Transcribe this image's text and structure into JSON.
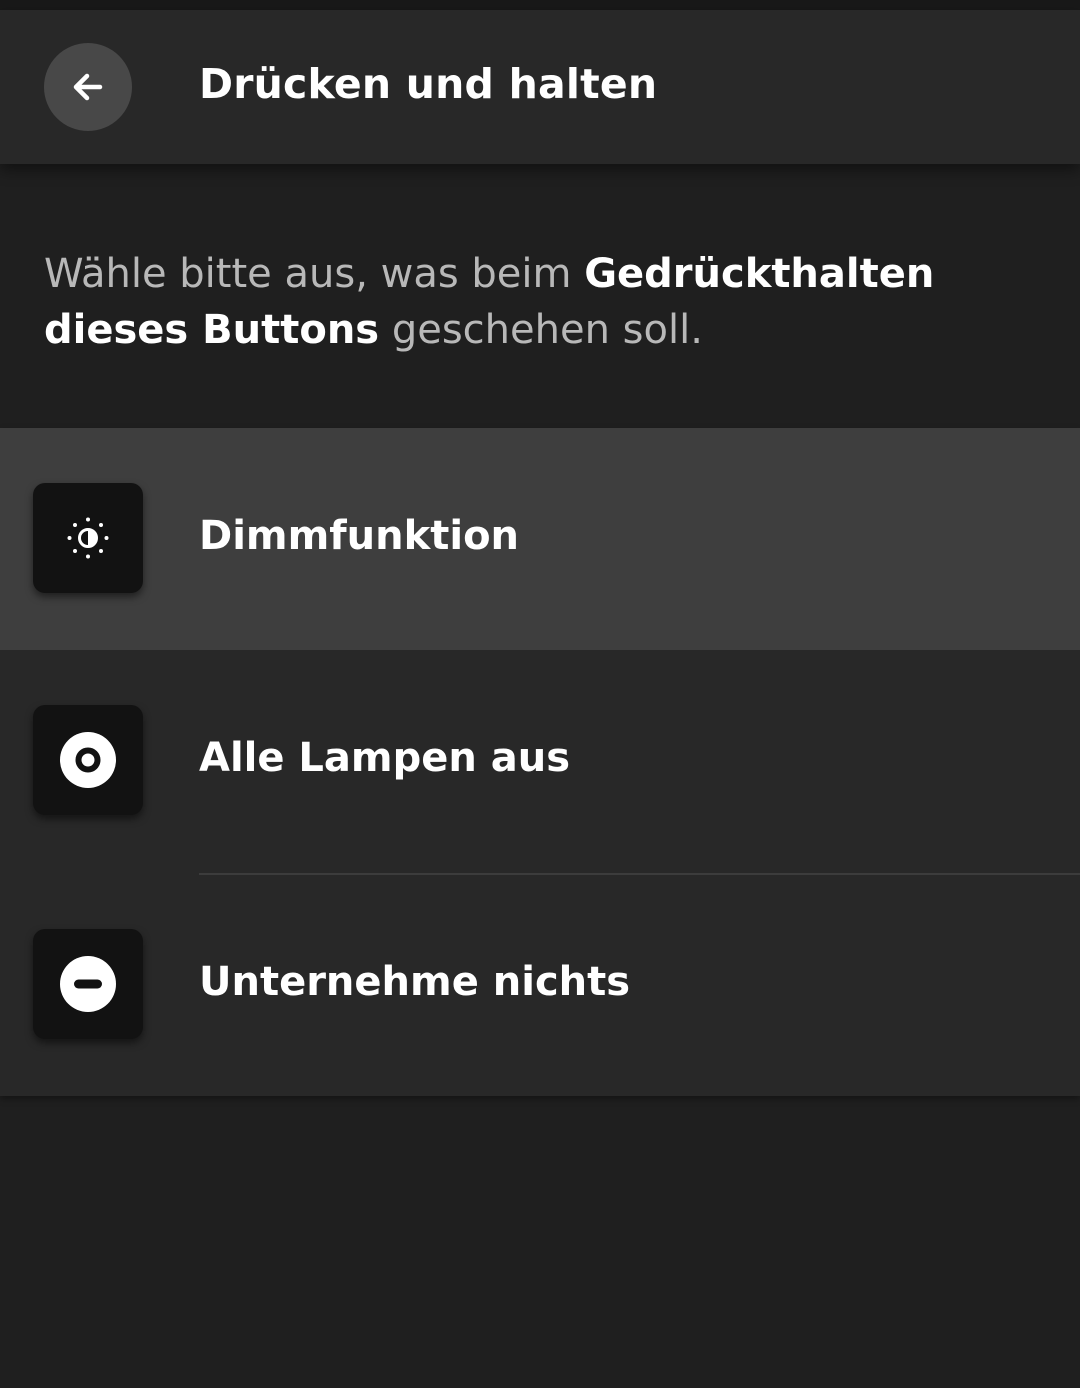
{
  "header": {
    "back_icon": "arrow-left-icon",
    "title": "Drücken und halten"
  },
  "description": {
    "part1": "Wähle bitte aus, was beim ",
    "bold1": "Gedrückthalten dieses Buttons",
    "part2": " geschehen soll."
  },
  "options": [
    {
      "label": "Dimmfunktion",
      "icon": "brightness-icon",
      "selected": true
    },
    {
      "label": "Alle Lampen aus",
      "icon": "power-off-icon",
      "selected": false
    },
    {
      "label": "Unternehme nichts",
      "icon": "do-nothing-icon",
      "selected": false
    }
  ],
  "colors": {
    "background": "#1f1f1f",
    "header": "#282828",
    "selected_row": "#3e3e3e",
    "icon_tile": "#121212",
    "muted_text": "#b8b8b8"
  }
}
